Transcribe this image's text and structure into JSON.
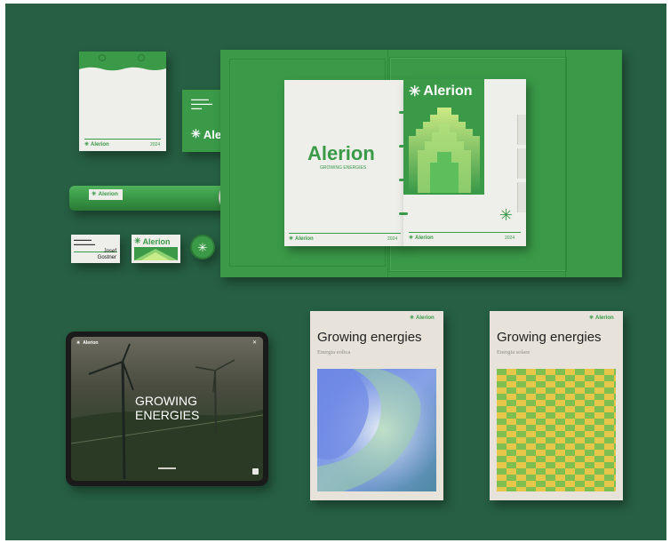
{
  "brand": {
    "name": "Alerion",
    "tagline": "GROWING ENERGIES",
    "year": "2024",
    "colors": {
      "background": "#265f43",
      "primary_green": "#3a9a48",
      "paper": "#eeeeea"
    }
  },
  "icons": {
    "logo_mark": "asterisk-icon",
    "close": "close-icon"
  },
  "notepad": {
    "logo": "Alerion",
    "year": "2024"
  },
  "envelope": {
    "logo": "Alerion",
    "name_tag": "Josef Gostner"
  },
  "tube": {
    "logo": "Alerion"
  },
  "business_card": {
    "first_name": "Josef",
    "last_name": "Gostner"
  },
  "folder_doc": {
    "logo": "Alerion",
    "tagline": "GROWING ENERGIES",
    "footer_logo": "Alerion",
    "year": "2024"
  },
  "binder": {
    "logo": "Alerion",
    "footer_logo": "Alerion",
    "year": "2024"
  },
  "tablet": {
    "logo": "Alerion",
    "headline_line1": "GROWING",
    "headline_line2": "ENERGIES"
  },
  "books": [
    {
      "logo": "Alerion",
      "title": "Growing energies",
      "subtitle": "Energia eolica"
    },
    {
      "logo": "Alerion",
      "title": "Growing energies",
      "subtitle": "Energia solare"
    }
  ]
}
